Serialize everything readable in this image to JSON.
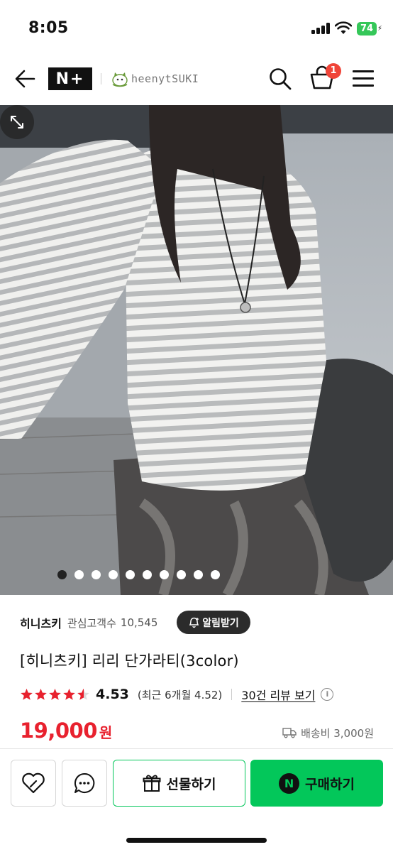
{
  "status_bar": {
    "time": "8:05",
    "battery": "74"
  },
  "nav": {
    "platform_logo": "N+",
    "shop_logo_text": "heenytSUKI",
    "cart_count": "1"
  },
  "product_image": {
    "active_slide": 1,
    "total_slides": 10
  },
  "brand": {
    "name": "히니츠키",
    "followers_label": "관심고객수",
    "followers_count": "10,545",
    "notify_label": "알림받기"
  },
  "product": {
    "title": "[히니츠키] 리리 단가라티(3color)",
    "rating": "4.53",
    "rating_fraction": 0.906,
    "recent_rating": "(최근 6개월 4.52)",
    "review_link": "30건 리뷰 보기",
    "price": "19,000",
    "price_unit": "원",
    "shipping": "배송비 3,000원"
  },
  "actions": {
    "gift_label": "선물하기",
    "buy_label": "구매하기",
    "buy_badge": "N"
  },
  "colors": {
    "accent_green": "#03c75a",
    "price_red": "#e8212e",
    "star_red": "#e8212e",
    "badge_red": "#f04438"
  }
}
